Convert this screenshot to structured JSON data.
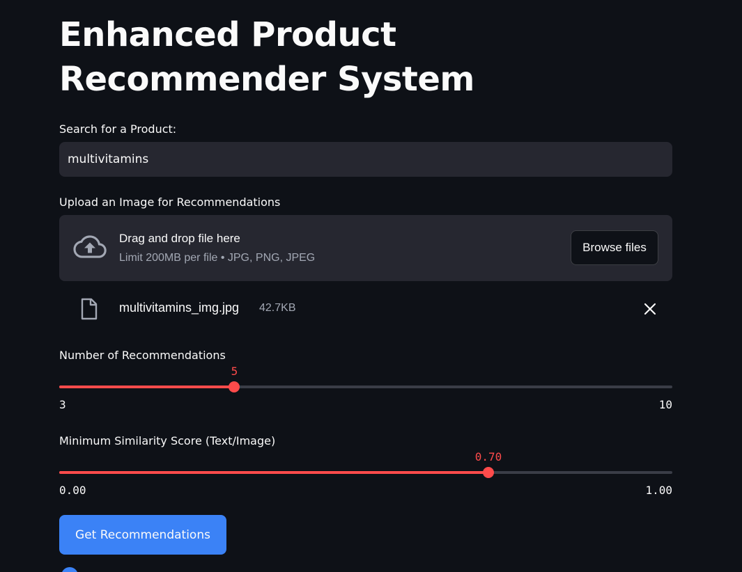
{
  "page": {
    "title": "Enhanced Product Recommender System"
  },
  "search": {
    "label": "Search for a Product:",
    "value": "multivitamins"
  },
  "upload": {
    "label": "Upload an Image for Recommendations",
    "dropzone_title": "Drag and drop file here",
    "dropzone_subtitle": "Limit 200MB per file • JPG, PNG, JPEG",
    "browse_label": "Browse files",
    "icon": "cloud-upload-icon",
    "file": {
      "name": "multivitamins_img.jpg",
      "size": "42.7KB",
      "icon": "file-icon",
      "remove_icon": "close-icon"
    }
  },
  "num_recommendations": {
    "label": "Number of Recommendations",
    "value": "5",
    "min": "3",
    "max": "10",
    "value_num": 5,
    "min_num": 3,
    "max_num": 10
  },
  "similarity": {
    "label": "Minimum Similarity Score (Text/Image)",
    "value": "0.70",
    "min": "0.00",
    "max": "1.00",
    "value_num": 0.7,
    "min_num": 0,
    "max_num": 1
  },
  "actions": {
    "submit_label": "Get Recommendations"
  },
  "colors": {
    "background": "#0e1117",
    "surface": "#262730",
    "accent": "#ff4b4b",
    "primary_button": "#3b82f6",
    "text": "#fafafa",
    "muted_text": "#a3a8b4"
  }
}
